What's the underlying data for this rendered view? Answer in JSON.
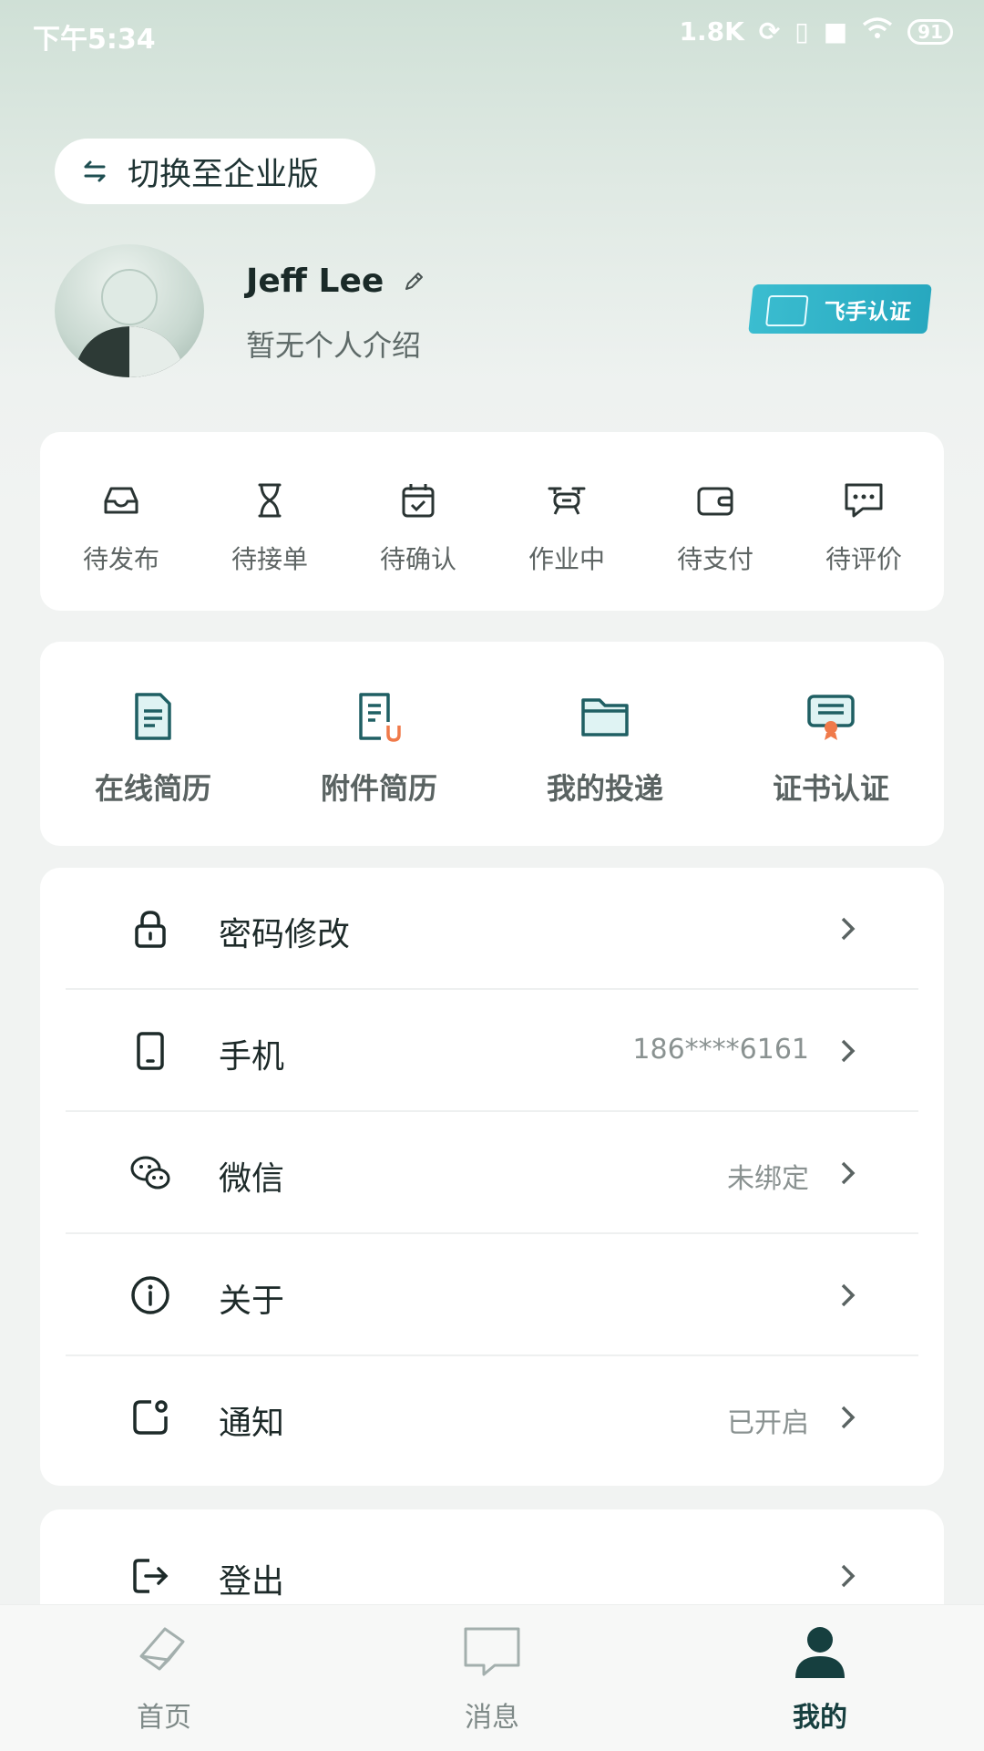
{
  "status_bar": {
    "time": "下午5:34",
    "net_speed": "1.8K",
    "battery": "91"
  },
  "header": {
    "switch_label": "切换至企业版"
  },
  "profile": {
    "name": "Jeff Lee",
    "bio": "暂无个人介绍",
    "badge": "飞手认证"
  },
  "orders": [
    {
      "label": "待发布",
      "icon": "inbox-icon"
    },
    {
      "label": "待接单",
      "icon": "hourglass-icon"
    },
    {
      "label": "待确认",
      "icon": "calendar-check-icon"
    },
    {
      "label": "作业中",
      "icon": "drone-icon"
    },
    {
      "label": "待支付",
      "icon": "wallet-icon"
    },
    {
      "label": "待评价",
      "icon": "comment-icon"
    }
  ],
  "resume": [
    {
      "label": "在线简历",
      "icon": "document-icon"
    },
    {
      "label": "附件简历",
      "icon": "attachment-document-icon"
    },
    {
      "label": "我的投递",
      "icon": "folder-icon"
    },
    {
      "label": "证书认证",
      "icon": "certificate-icon"
    }
  ],
  "settings": [
    {
      "label": "密码修改",
      "value": "",
      "icon": "lock-icon"
    },
    {
      "label": "手机",
      "value": "186****6161",
      "icon": "phone-icon"
    },
    {
      "label": "微信",
      "value": "未绑定",
      "icon": "wechat-icon"
    },
    {
      "label": "关于",
      "value": "",
      "icon": "info-icon"
    },
    {
      "label": "通知",
      "value": "已开启",
      "icon": "notification-icon"
    }
  ],
  "logout": {
    "label": "登出",
    "icon": "logout-icon"
  },
  "tabs": [
    {
      "label": "首页",
      "icon": "home-icon",
      "active": false
    },
    {
      "label": "消息",
      "icon": "message-icon",
      "active": false
    },
    {
      "label": "我的",
      "icon": "user-icon",
      "active": true
    }
  ],
  "colors": {
    "accent": "#1f5f63",
    "teal_icon": "#2a8a8e",
    "badge": "#2fb3c8",
    "orange": "#f07a4a"
  }
}
